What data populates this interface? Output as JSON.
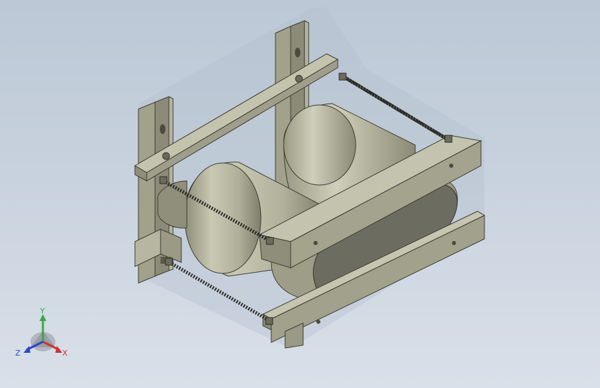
{
  "viewport": {
    "background_top": "#bcc8d6",
    "background_bottom": "#d9e0e9"
  },
  "model": {
    "parts": [
      "upright-channel-left",
      "upright-channel-right",
      "top-rail-back",
      "top-rail-front",
      "bottom-rail-back",
      "bottom-rail-front",
      "winding-coil-upper",
      "winding-coil-lower",
      "threaded-rod-top-back",
      "threaded-rod-top-front",
      "threaded-rod-bottom",
      "nut-set"
    ],
    "part_color": "#a8a894",
    "part_shadow": "#6e6e5e",
    "coil_color": "#b9b9a2",
    "rod_color": "#2a2a26"
  },
  "triad": {
    "y_label": "Y",
    "z_label": "Z",
    "x_label": "X",
    "y_color": "#3aa845",
    "z_color": "#2a48c8",
    "x_color": "#d43030"
  }
}
